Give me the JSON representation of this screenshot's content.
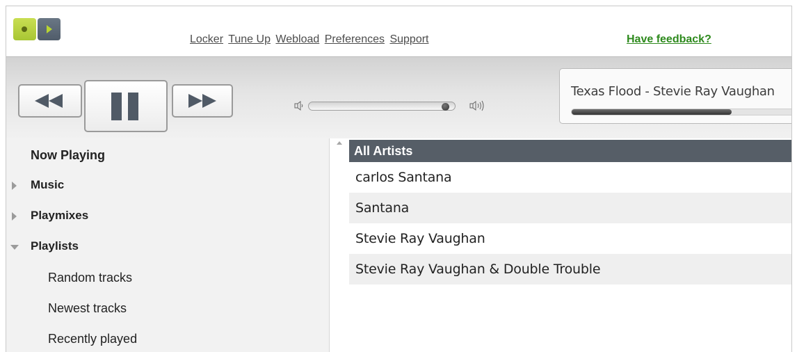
{
  "topbar": {
    "links": [
      "Locker",
      "Tune Up",
      "Webload",
      "Preferences",
      "Support"
    ],
    "feedback": "Have feedback?"
  },
  "player": {
    "now_playing": "Texas Flood - Stevie Ray Vaughan",
    "volume_percent": 96,
    "progress_percent": 68
  },
  "sidebar": {
    "now_playing": "Now Playing",
    "sections": [
      {
        "label": "Music",
        "expanded": false
      },
      {
        "label": "Playmixes",
        "expanded": false
      },
      {
        "label": "Playlists",
        "expanded": true
      }
    ],
    "playlists": [
      "Random tracks",
      "Newest tracks",
      "Recently played"
    ]
  },
  "artists": {
    "header": "All Artists",
    "rows": [
      "carlos Santana",
      "Santana",
      "Stevie Ray Vaughan",
      "Stevie Ray Vaughan & Double Trouble"
    ]
  },
  "colors": {
    "brand_green": "#b8d432",
    "feedback_green": "#2e8a1d",
    "header_gray": "#565e67"
  }
}
